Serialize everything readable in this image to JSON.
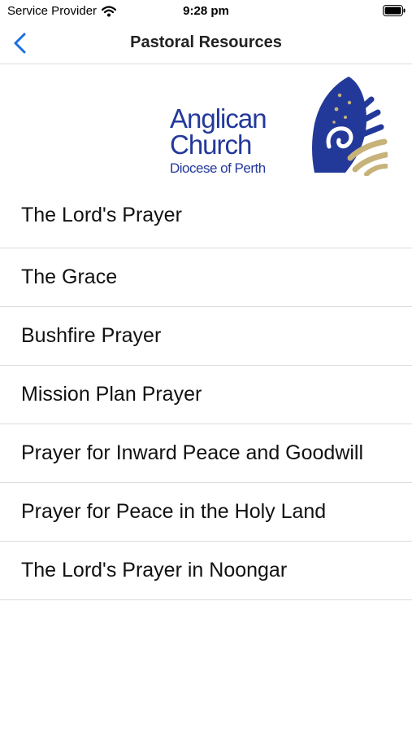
{
  "status_bar": {
    "carrier": "Service Provider",
    "time": "9:28 pm",
    "icons": [
      "wifi-icon",
      "battery-icon"
    ]
  },
  "nav": {
    "title": "Pastoral Resources",
    "back_icon": "chevron-left-icon"
  },
  "logo": {
    "line1": "Anglican",
    "line2": "Church",
    "line3": "Diocese of Perth"
  },
  "colors": {
    "accent": "#1a6fe0",
    "logo_blue": "#23399a",
    "logo_gold": "#c7b27a",
    "divider": "#dcdcdc"
  },
  "items": [
    {
      "label": "The Lord's Prayer"
    },
    {
      "label": "The Grace"
    },
    {
      "label": "Bushfire Prayer"
    },
    {
      "label": "Mission Plan Prayer"
    },
    {
      "label": "Prayer for Inward Peace and Goodwill"
    },
    {
      "label": "Prayer for Peace in the Holy Land"
    },
    {
      "label": "The Lord's Prayer in Noongar"
    }
  ]
}
